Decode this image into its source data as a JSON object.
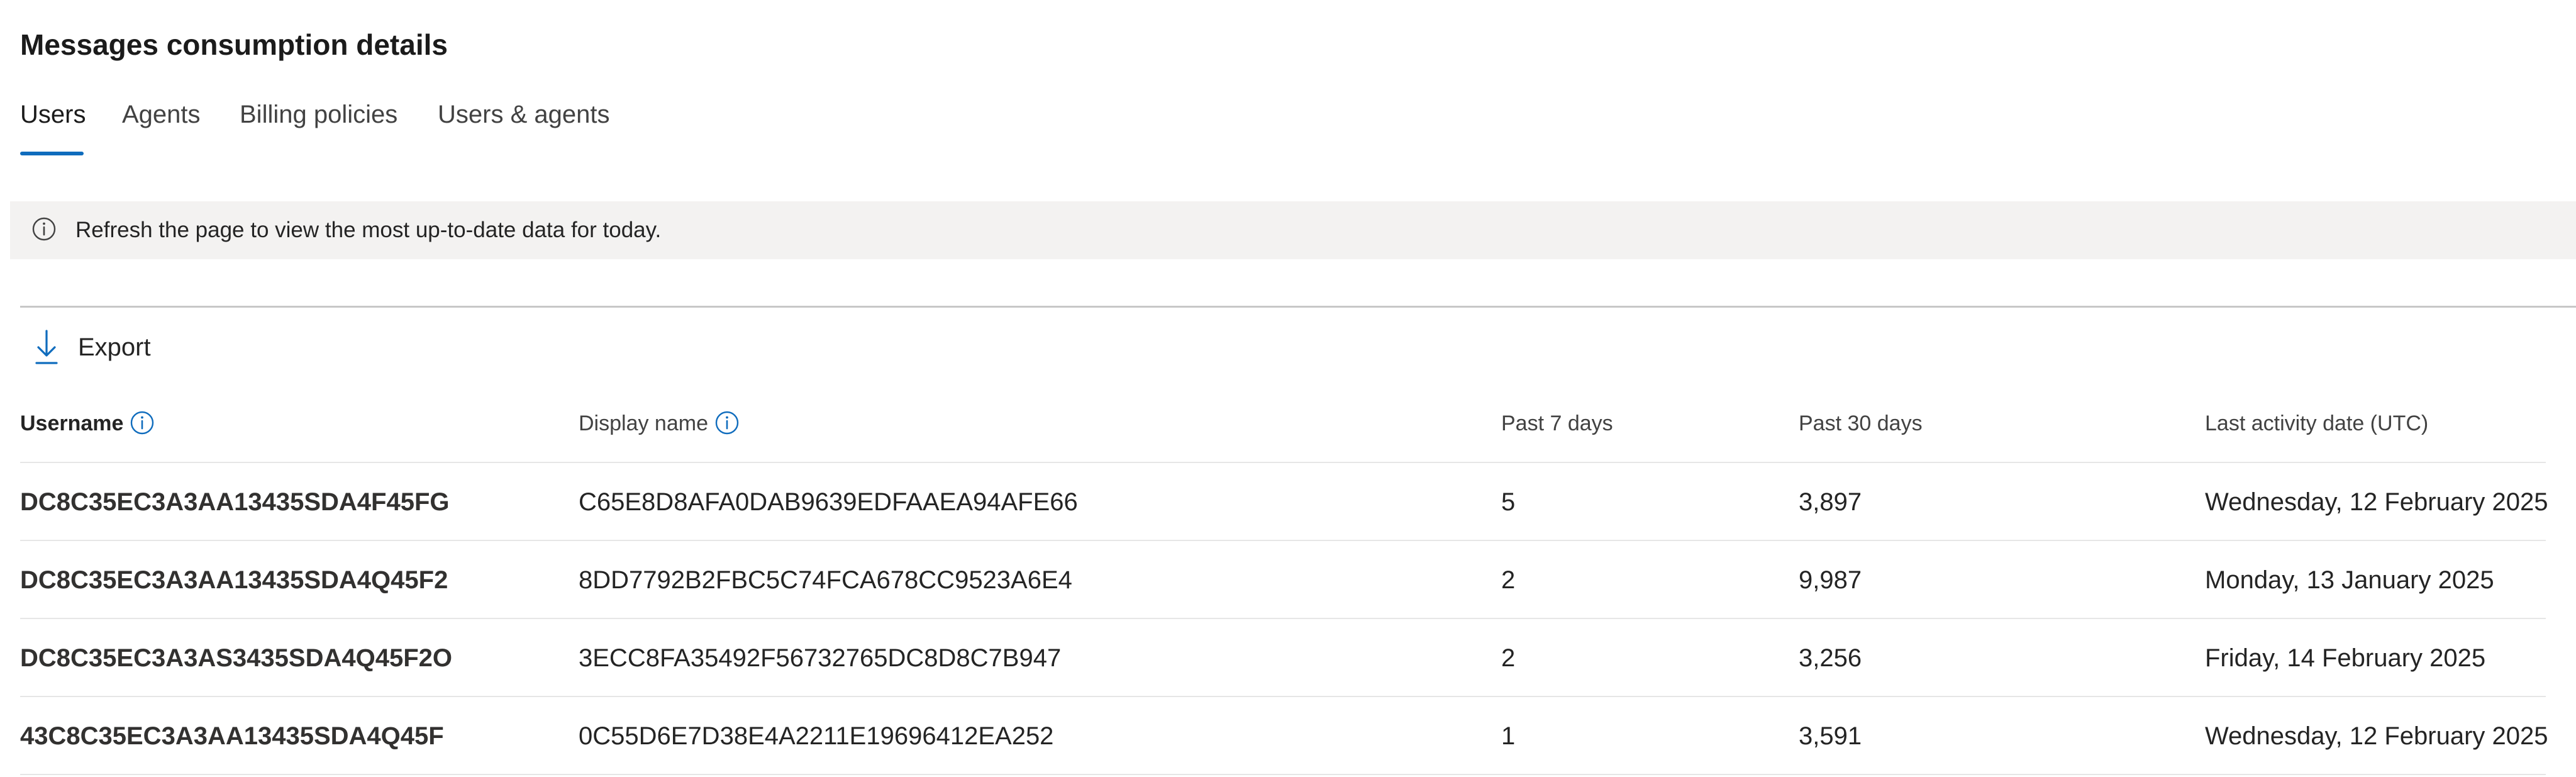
{
  "page_title": "Messages consumption details",
  "tabs": [
    {
      "label": "Users",
      "active": true
    },
    {
      "label": "Agents",
      "active": false
    },
    {
      "label": "Billing policies",
      "active": false
    },
    {
      "label": "Users & agents",
      "active": false
    }
  ],
  "info_bar": {
    "icon": "info-icon",
    "message": "Refresh the page to view the most up-to-date data for today."
  },
  "toolbar": {
    "export_label": "Export",
    "export_icon": "download-icon"
  },
  "table": {
    "columns": [
      "Username",
      "Display name",
      "Past 7 days",
      "Past 30 days",
      "Last activity date (UTC)"
    ],
    "rows": [
      {
        "username": "DC8C35EC3A3AA13435SDA4F45FG",
        "display_name": "C65E8D8AFA0DAB9639EDFAAEA94AFE66",
        "past_7_days": "5",
        "past_30_days": "3,897",
        "last_activity": "Wednesday, 12 February 2025"
      },
      {
        "username": "DC8C35EC3A3AA13435SDA4Q45F2",
        "display_name": "8DD7792B2FBC5C74FCA678CC9523A6E4",
        "past_7_days": "2",
        "past_30_days": "9,987",
        "last_activity": "Monday, 13 January 2025"
      },
      {
        "username": "DC8C35EC3A3AS3435SDA4Q45F2O",
        "display_name": "3ECC8FA35492F56732765DC8D8C7B947",
        "past_7_days": "2",
        "past_30_days": "3,256",
        "last_activity": "Friday, 14 February 2025"
      },
      {
        "username": "43C8C35EC3A3AA13435SDA4Q45F",
        "display_name": "0C55D6E7D38E4A2211E19696412EA252",
        "past_7_days": "1",
        "past_30_days": "3,591",
        "last_activity": "Wednesday, 12 February 2025"
      }
    ]
  },
  "colors": {
    "accent": "#0f6cbd",
    "info_bar_bg": "#f3f2f1",
    "divider": "#c7c7c7"
  }
}
